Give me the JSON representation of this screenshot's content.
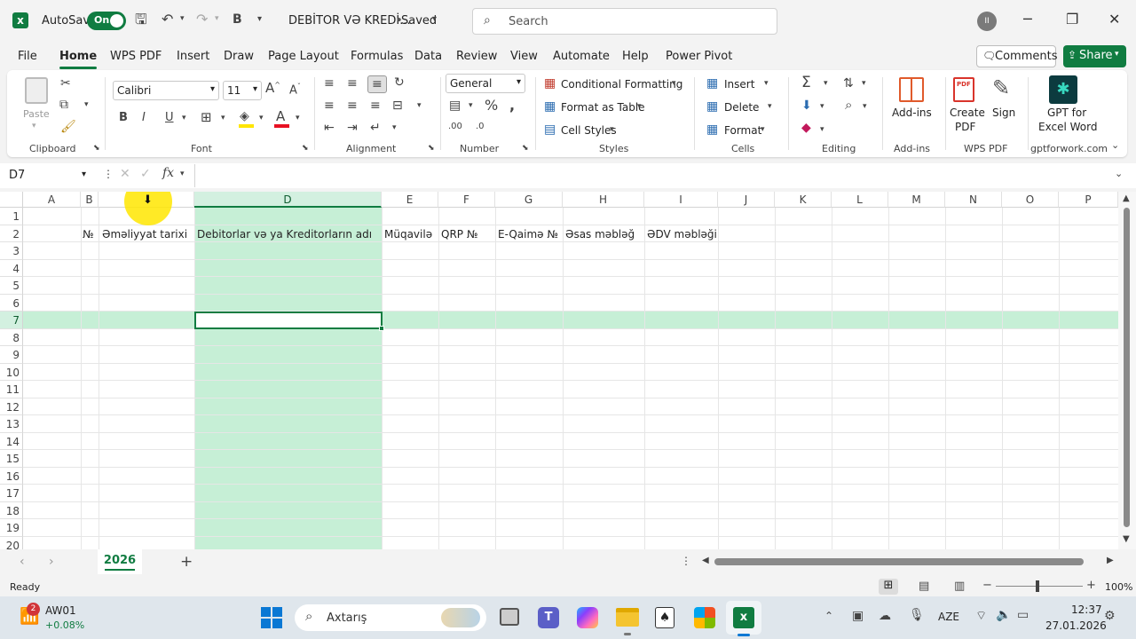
{
  "titlebar": {
    "autosave_label": "AutoSave",
    "autosave_state": "On",
    "doc_title": "DEBİTOR VƏ KREDİ...",
    "doc_status": "Saved",
    "search_placeholder": "Search"
  },
  "menu": [
    "File",
    "Home",
    "WPS PDF",
    "Insert",
    "Draw",
    "Page Layout",
    "Formulas",
    "Data",
    "Review",
    "View",
    "Automate",
    "Help",
    "Power Pivot"
  ],
  "comments_label": "Comments",
  "share_label": "Share",
  "ribbon": {
    "clipboard": {
      "paste": "Paste",
      "label": "Clipboard"
    },
    "font": {
      "name": "Calibri",
      "size": "11",
      "label": "Font"
    },
    "alignment": {
      "label": "Alignment"
    },
    "number": {
      "format": "General",
      "label": "Number"
    },
    "styles": {
      "conditional": "Conditional Formatting",
      "format_table": "Format as Table",
      "cell_styles": "Cell Styles",
      "label": "Styles"
    },
    "cells": {
      "insert": "Insert",
      "delete": "Delete",
      "format": "Format",
      "label": "Cells"
    },
    "editing": {
      "label": "Editing"
    },
    "addins": {
      "btn": "Add-ins",
      "label": "Add-ins"
    },
    "wps": {
      "create": "Create",
      "pdf": "PDF",
      "sign": "Sign",
      "label": "WPS PDF"
    },
    "gpt": {
      "line1": "GPT for",
      "line2": "Excel Word",
      "label": "gptforwork.com"
    }
  },
  "formula_bar": {
    "name_box": "D7",
    "fx": "fx",
    "value": ""
  },
  "columns": [
    "A",
    "B",
    "C",
    "D",
    "E",
    "F",
    "G",
    "H",
    "I",
    "J",
    "K",
    "L",
    "M",
    "N",
    "O",
    "P"
  ],
  "rows": [
    "1",
    "2",
    "3",
    "4",
    "5",
    "6",
    "7",
    "8",
    "9",
    "10",
    "11",
    "12",
    "13",
    "14",
    "15",
    "16",
    "17",
    "18",
    "19",
    "20"
  ],
  "selected_cell": "D7",
  "headers_row2": {
    "B": "№",
    "C": "Əməliyyat tarixi",
    "D": "Debitorlar və ya Kreditorların adı",
    "E": "Müqavilə",
    "F": "QRP №",
    "G": "E-Qaimə №",
    "H": "Əsas məbləğ",
    "I": "ƏDV məbləği"
  },
  "sheet_tab": "2026",
  "status": {
    "ready": "Ready",
    "zoom": "100%"
  },
  "taskbar": {
    "ticker_badge": "2",
    "ticker_name": "AW01",
    "ticker_change": "+0.08%",
    "search": "Axtarış",
    "lang": "AZE",
    "time": "12:37",
    "date": "27.01.2026"
  },
  "colors": {
    "accent": "#107c41",
    "selection": "#c6efd6"
  }
}
